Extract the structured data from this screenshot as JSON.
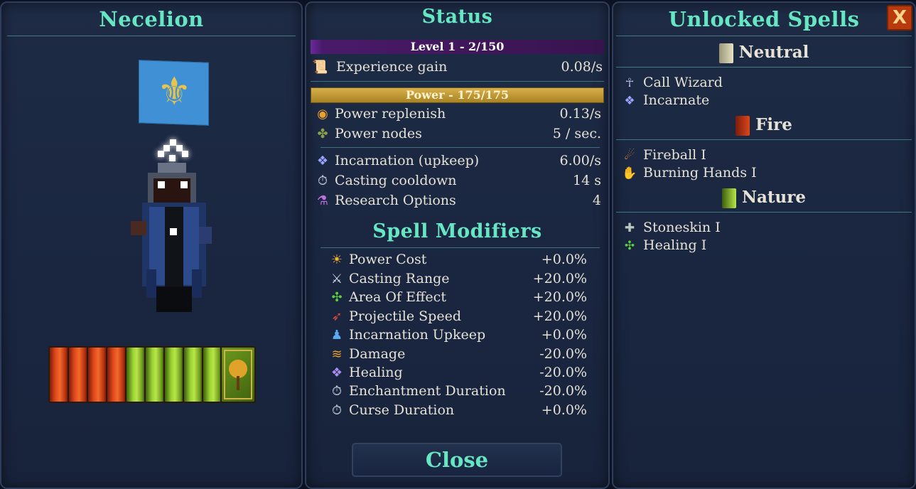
{
  "character": {
    "name": "Necelion",
    "flag_emblem": "fleur-de-lis",
    "books": [
      "fire",
      "fire",
      "fire",
      "fire",
      "nature",
      "nature",
      "nature",
      "nature",
      "nature",
      "nature-cover"
    ]
  },
  "status": {
    "title": "Status",
    "level_bar": "Level 1 - 2/150",
    "level_progress": 0.0133,
    "experience": {
      "label": "Experience gain",
      "value": "0.08/s",
      "icon": "scroll-icon"
    },
    "power_bar": "Power - 175/175",
    "power_progress": 1.0,
    "power_rows": [
      {
        "label": "Power replenish",
        "value": "0.13/s",
        "icon": "power-orb-icon"
      },
      {
        "label": "Power nodes",
        "value": "5 / sec.",
        "icon": "node-icon"
      }
    ],
    "misc_rows": [
      {
        "label": "Incarnation (upkeep)",
        "value": "6.00/s",
        "icon": "incarnation-icon"
      },
      {
        "label": "Casting cooldown",
        "value": "14 s",
        "icon": "stopwatch-icon"
      },
      {
        "label": "Research Options",
        "value": "4",
        "icon": "potion-icon"
      }
    ],
    "modifiers_title": "Spell Modifiers",
    "modifiers": [
      {
        "label": "Power Cost",
        "value": "+0.0%",
        "icon": "sun-icon"
      },
      {
        "label": "Casting Range",
        "value": "+20.0%",
        "icon": "sword-icon"
      },
      {
        "label": "Area Of Effect",
        "value": "+20.0%",
        "icon": "clover-icon"
      },
      {
        "label": "Projectile Speed",
        "value": "+20.0%",
        "icon": "wing-icon"
      },
      {
        "label": "Incarnation Upkeep",
        "value": "+0.0%",
        "icon": "pedestal-icon"
      },
      {
        "label": "Damage",
        "value": "-20.0%",
        "icon": "claw-icon"
      },
      {
        "label": "Healing",
        "value": "-20.0%",
        "icon": "healing-icon"
      },
      {
        "label": "Enchantment Duration",
        "value": "-20.0%",
        "icon": "stopwatch-icon"
      },
      {
        "label": "Curse Duration",
        "value": "+0.0%",
        "icon": "stopwatch-icon"
      }
    ],
    "close_label": "Close"
  },
  "spells": {
    "title": "Unlocked Spells",
    "close_x": "X",
    "categories": [
      {
        "name": "Neutral",
        "color": "#d9d3b4",
        "items": [
          {
            "label": "Call Wizard",
            "icon": "wizard-icon"
          },
          {
            "label": "Incarnate",
            "icon": "incarnate-icon"
          }
        ]
      },
      {
        "name": "Fire",
        "color": "#d9421a",
        "items": [
          {
            "label": "Fireball I",
            "icon": "fireball-icon"
          },
          {
            "label": "Burning Hands I",
            "icon": "burning-hands-icon"
          }
        ]
      },
      {
        "name": "Nature",
        "color": "#8fc128",
        "items": [
          {
            "label": "Stoneskin I",
            "icon": "stoneskin-icon"
          },
          {
            "label": "Healing I",
            "icon": "healing-icon"
          }
        ]
      }
    ]
  },
  "colors": {
    "accent": "#67e6c3",
    "level_bar": "#5b1f7d",
    "power_bar": "#c39a34"
  }
}
